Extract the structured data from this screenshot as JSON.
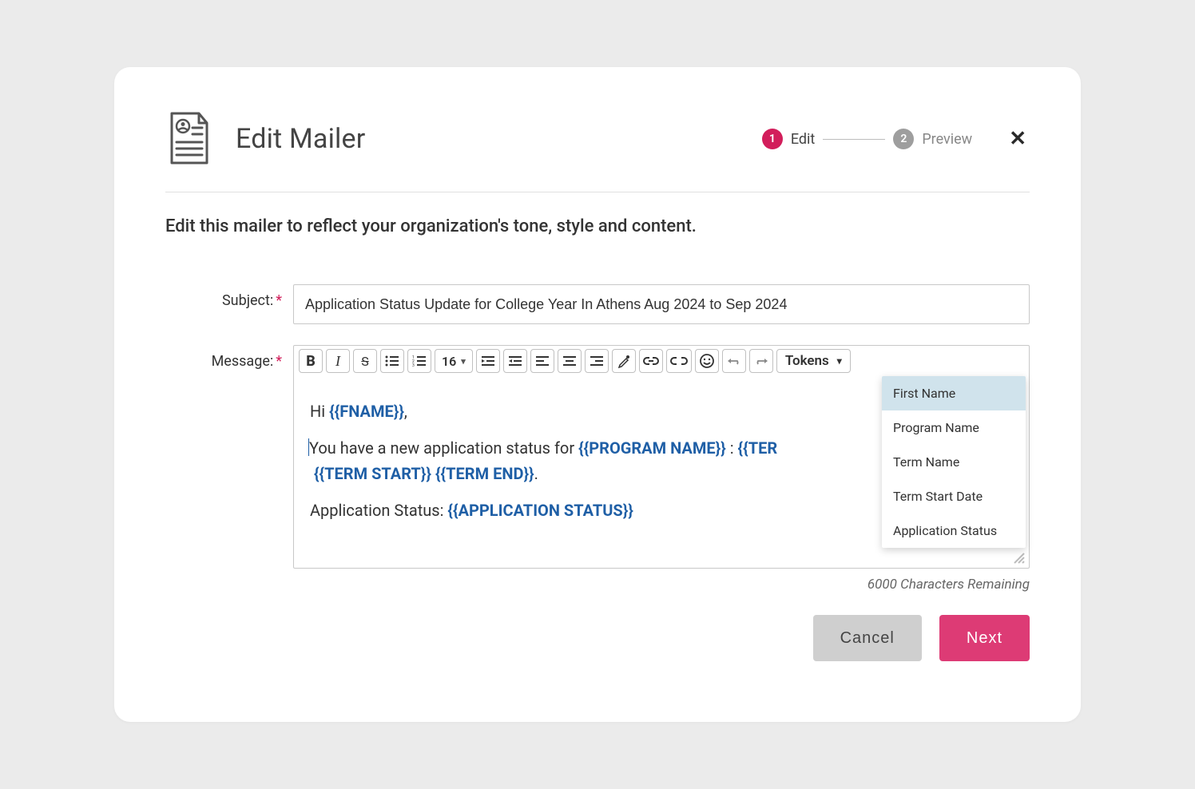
{
  "header": {
    "title": "Edit Mailer",
    "step1_num": "1",
    "step1_label": "Edit",
    "step2_num": "2",
    "step2_label": "Preview"
  },
  "instruction": "Edit this mailer to reflect your organization's tone, style and content.",
  "form": {
    "subject_label": "Subject:",
    "subject_value": "Application Status Update for College Year In Athens Aug 2024 to Sep 2024",
    "message_label": "Message:",
    "font_size": "16",
    "tokens_label": "Tokens"
  },
  "editor": {
    "greeting_pre": "Hi ",
    "greeting_token": "{{FNAME}}",
    "greeting_post": ",",
    "line2_pre": "You have a new  application status for ",
    "line2_tok1": "{{PROGRAM NAME}}",
    "line2_mid": " : ",
    "line2_tok2": "{{TER",
    "line3_tok1": "{{TERM START}}",
    "line3_sp": " ",
    "line3_tok2": "{{TERM END}}",
    "line3_post": ".",
    "line4_pre": "Application Status: ",
    "line4_tok": "{{APPLICATION STATUS}}"
  },
  "dropdown": {
    "options": [
      "First Name",
      "Program Name",
      "Term Name",
      "Term Start Date",
      "Application Status"
    ]
  },
  "chars_remaining": "6000 Characters Remaining",
  "buttons": {
    "cancel": "Cancel",
    "next": "Next"
  }
}
